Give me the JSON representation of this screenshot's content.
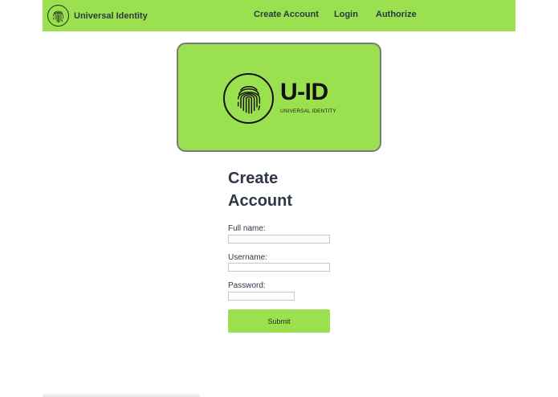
{
  "navbar": {
    "brand_name": "Universal Identity",
    "links": [
      {
        "label": "Create Account"
      },
      {
        "label": "Login"
      },
      {
        "label": "Authorize"
      }
    ]
  },
  "hero": {
    "title": "U-ID",
    "subtitle": "UNIVERSAL IDENTITY",
    "icon": "fingerprint-icon"
  },
  "form": {
    "heading": "Create Account",
    "fields": [
      {
        "label": "Full name:",
        "value": "",
        "placeholder": ""
      },
      {
        "label": "Username:",
        "value": "",
        "placeholder": ""
      },
      {
        "label": "Password:",
        "value": "",
        "placeholder": ""
      }
    ],
    "submit_label": "Submit"
  },
  "colors": {
    "accent": "#9be04f",
    "text": "#2d3748",
    "card_border": "#7a7a7a"
  }
}
